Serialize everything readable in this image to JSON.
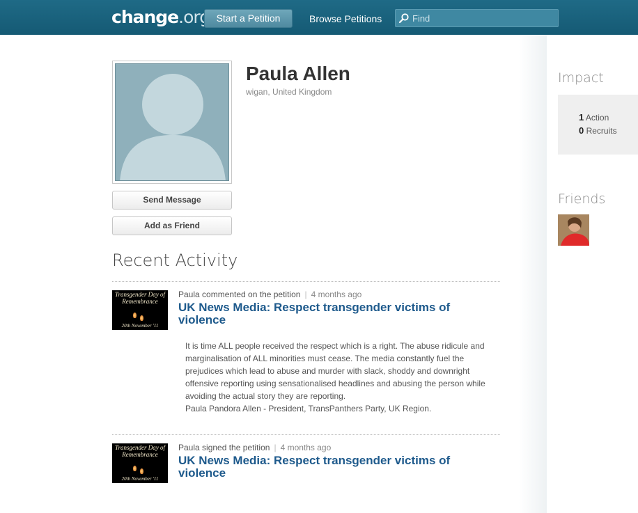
{
  "header": {
    "logo_main": "change",
    "logo_suffix": ".org",
    "start_petition": "Start a Petition",
    "browse_petitions": "Browse Petitions",
    "search_placeholder": "Find"
  },
  "profile": {
    "name": "Paula Allen",
    "location": "wigan, United Kingdom",
    "send_message": "Send Message",
    "add_friend": "Add as Friend"
  },
  "recent_activity": {
    "title": "Recent Activity",
    "items": [
      {
        "actor_action": "Paula commented on the petition",
        "time": "4 months ago",
        "petition_title": "UK News Media: Respect transgender victims of violence",
        "thumb_title": "Transgender Day of Remembrance",
        "thumb_date": "20th November '11",
        "comment": "It is time ALL people received the respect which is a right. The abuse ridicule and marginalisation of ALL minorities must cease. The media constantly fuel the prejudices which lead to abuse and murder with slack, shoddy and downright offensive reporting using sensationalised headlines and abusing the person while avoiding the actual story they are reporting.",
        "signature": "Paula Pandora Allen - President, TransPanthers Party, UK Region."
      },
      {
        "actor_action": "Paula signed the petition",
        "time": "4 months ago",
        "petition_title": "UK News Media: Respect transgender victims of violence",
        "thumb_title": "Transgender Day of Remembrance",
        "thumb_date": "20th November '11"
      }
    ]
  },
  "sidebar": {
    "impact_title": "Impact",
    "actions_count": "1",
    "actions_label": "Action",
    "recruits_count": "0",
    "recruits_label": "Recruits",
    "friends_title": "Friends"
  },
  "colors": {
    "header_bg": "#1a6380",
    "link": "#1e5a8c",
    "avatar_bg": "#8fb0bb"
  }
}
